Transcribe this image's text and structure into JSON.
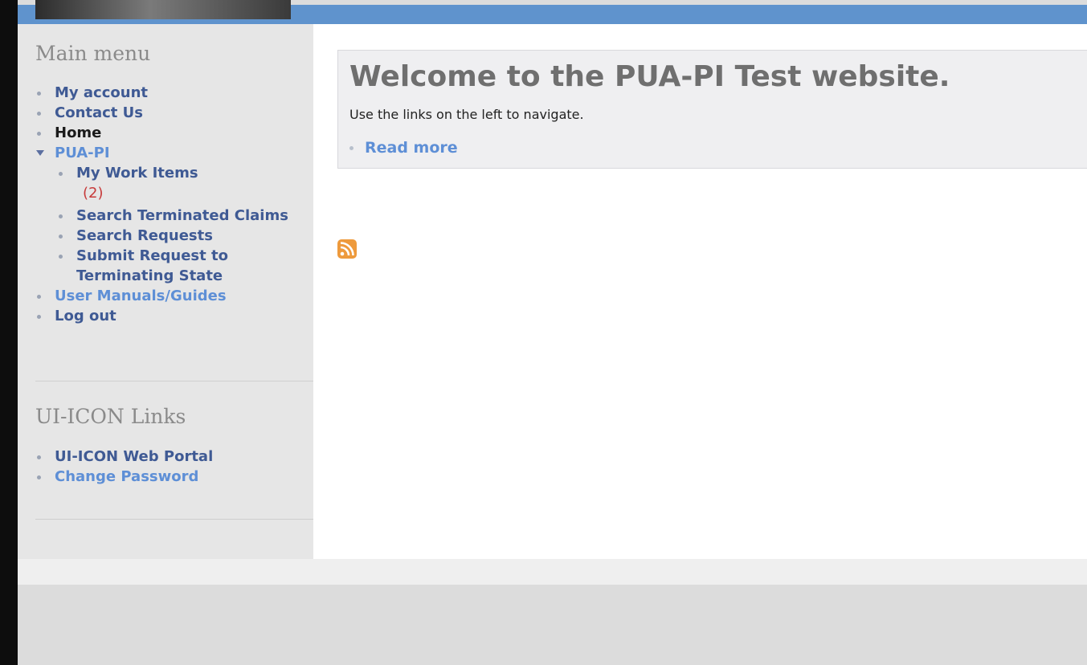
{
  "sidebar": {
    "main_menu": {
      "title": "Main menu",
      "items": [
        {
          "label": "My account"
        },
        {
          "label": "Contact Us"
        },
        {
          "label": "Home"
        },
        {
          "label": "PUA-PI",
          "children": [
            {
              "label": "My Work Items",
              "count": "(2)"
            },
            {
              "label": "Search Terminated Claims"
            },
            {
              "label": "Search Requests"
            },
            {
              "label": "Submit Request to Terminating State"
            }
          ]
        },
        {
          "label": "User Manuals/Guides"
        },
        {
          "label": "Log out"
        }
      ]
    },
    "uiicon_links": {
      "title": "UI-ICON Links",
      "items": [
        {
          "label": "UI-ICON Web Portal"
        },
        {
          "label": "Change Password"
        }
      ]
    }
  },
  "content": {
    "title": "Welcome to the PUA-PI Test website.",
    "body": "Use the links on the left to navigate.",
    "read_more": "Read more",
    "feed_icon": "rss-feed-icon"
  },
  "colors": {
    "header_bar": "#5f93cd",
    "link": "#3f5a94",
    "link_light": "#5e8fd6",
    "count": "#c73a3a",
    "feed_icon": "#ee9a3c"
  }
}
